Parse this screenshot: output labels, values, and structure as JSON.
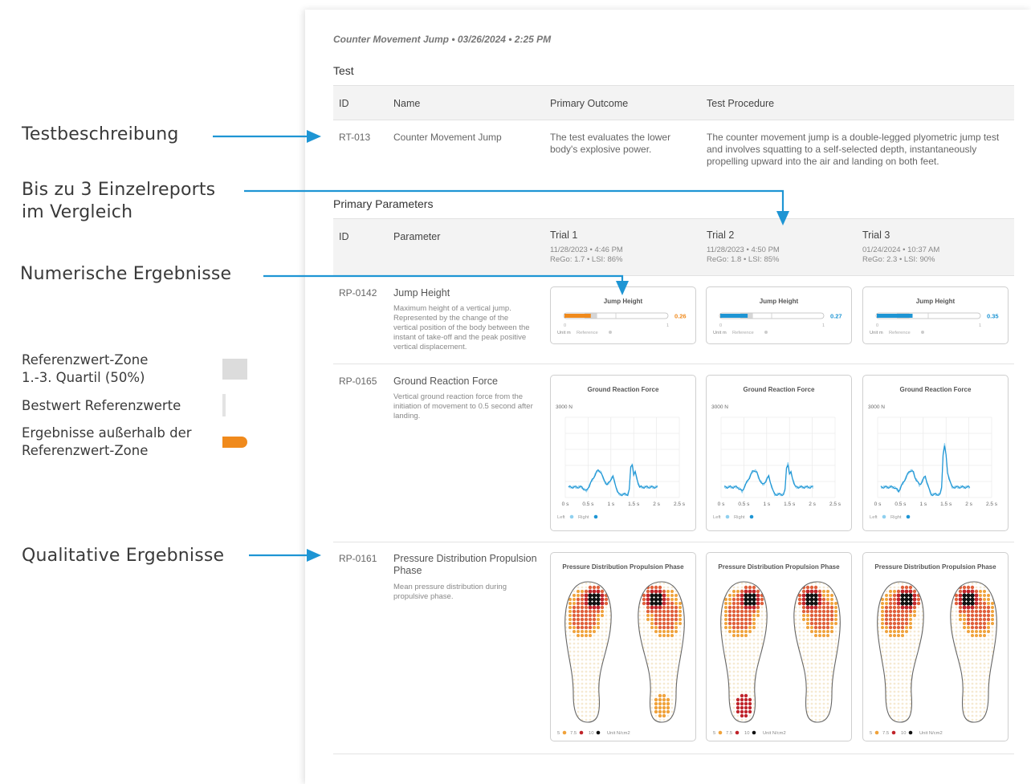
{
  "annotations": {
    "test_description": "Testbeschreibung",
    "compare_line1": "Bis zu 3 Einzelreports",
    "compare_line2": "im Vergleich",
    "numeric": "Numerische Ergebnisse",
    "qualitative": "Qualitative Ergebnisse"
  },
  "legend": {
    "zone_line1": "Referenzwert-Zone",
    "zone_line2": "1.-3. Quartil (50%)",
    "best": "Bestwert Referenzwerte",
    "outside_line1": "Ergebnisse außerhalb der",
    "outside_line2": "Referenzwert-Zone"
  },
  "report": {
    "header": "Counter Movement Jump • 03/26/2024 • 2:25 PM",
    "test_section": "Test",
    "test_columns": {
      "id": "ID",
      "name": "Name",
      "outcome": "Primary Outcome",
      "procedure": "Test Procedure"
    },
    "test_row": {
      "id": "RT-013",
      "name": "Counter Movement Jump",
      "outcome": "The test evaluates the lower body's explosive power.",
      "procedure": "The counter movement jump is a double-legged plyometric jump test and involves squatting to a self-selected depth, instantaneously propelling upward into the air and landing on both feet."
    },
    "params_section": "Primary Parameters",
    "param_columns": {
      "id": "ID",
      "parameter": "Parameter"
    },
    "trials": [
      {
        "name": "Trial 1",
        "date": "11/28/2023 • 4:46 PM",
        "rego": "ReGo: 1.7 • LSI: 86%"
      },
      {
        "name": "Trial 2",
        "date": "11/28/2023 • 4:50 PM",
        "rego": "ReGo: 1.8 • LSI: 85%"
      },
      {
        "name": "Trial 3",
        "date": "01/24/2024 • 10:37 AM",
        "rego": "ReGo: 2.3 • LSI: 90%"
      }
    ],
    "params": [
      {
        "id": "RP-0142",
        "name": "Jump Height",
        "desc": "Maximum height of a vertical jump. Represented by the change of the vertical position of the body between the instant of take-off and the peak positive vertical displacement."
      },
      {
        "id": "RP-0165",
        "name": "Ground Reaction Force",
        "desc": "Vertical ground reaction force from the initiation of movement to 0.5 second after landing."
      },
      {
        "id": "RP-0161",
        "name": "Pressure Distribution Propulsion Phase",
        "desc": "Mean pressure distribution during propulsive phase."
      }
    ],
    "jump_cards": [
      {
        "title": "Jump Height",
        "value": "0.26",
        "fraction": 0.26,
        "color": "#f08a1c",
        "tick_min": "0",
        "tick_max": "1",
        "unit": "Unit m",
        "reference": "Reference"
      },
      {
        "title": "Jump Height",
        "value": "0.27",
        "fraction": 0.27,
        "color": "#1e95d4",
        "tick_min": "0",
        "tick_max": "1",
        "unit": "Unit m",
        "reference": "Reference"
      },
      {
        "title": "Jump Height",
        "value": "0.35",
        "fraction": 0.35,
        "color": "#1e95d4",
        "tick_min": "0",
        "tick_max": "1",
        "unit": "Unit m",
        "reference": "Reference"
      }
    ],
    "reference_zone": [
      0.2,
      0.32
    ],
    "grf_cards": [
      {
        "title": "Ground Reaction Force",
        "ymax_label": "3000 N",
        "x_ticks": [
          "0 s",
          "0.5 s",
          "1 s",
          "1.5 s",
          "2 s",
          "2.5 s"
        ],
        "left": "Left",
        "right": "Right"
      },
      {
        "title": "Ground Reaction Force",
        "ymax_label": "3000 N",
        "x_ticks": [
          "0 s",
          "0.5 s",
          "1 s",
          "1.5 s",
          "2 s",
          "2.5 s"
        ],
        "left": "Left",
        "right": "Right"
      },
      {
        "title": "Ground Reaction Force",
        "ymax_label": "3000 N",
        "x_ticks": [
          "0 s",
          "0.5 s",
          "1 s",
          "1.5 s",
          "2 s",
          "2.5 s"
        ],
        "left": "Left",
        "right": "Right"
      }
    ],
    "pressure_cards": [
      {
        "title": "Pressure Distribution Propulsion Phase",
        "l5": "5",
        "l75": "7.5",
        "l10": "10",
        "unit": "Unit N/cm2"
      },
      {
        "title": "Pressure Distribution Propulsion Phase",
        "l5": "5",
        "l75": "7.5",
        "l10": "10",
        "unit": "Unit N/cm2"
      },
      {
        "title": "Pressure Distribution Propulsion Phase",
        "l5": "5",
        "l75": "7.5",
        "l10": "10",
        "unit": "Unit N/cm2"
      }
    ],
    "colors": {
      "accent": "#1e95d4",
      "outlier": "#f08a1c",
      "reference_zone": "#d6d6d6",
      "pressure_high": "#111111",
      "pressure_mid": "#c0242a",
      "pressure_low": "#f0a23a"
    }
  }
}
